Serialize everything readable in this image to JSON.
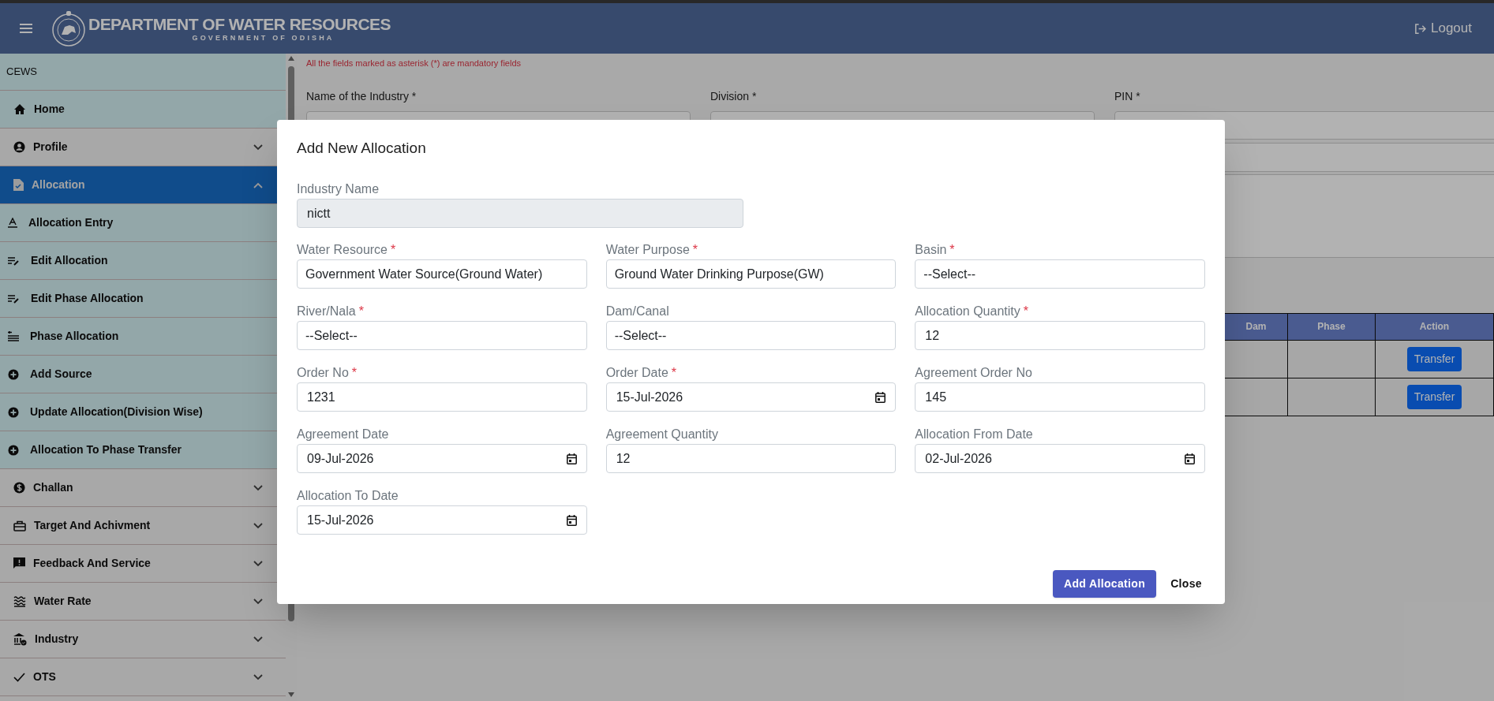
{
  "header": {
    "title": "DEPARTMENT OF WATER RESOURCES",
    "subtitle": "GOVERNMENT OF ODISHA",
    "logout": "Logout"
  },
  "sidebar": {
    "title": "CEWS",
    "items": [
      {
        "label": "Home",
        "kind": "link",
        "selected": false
      },
      {
        "label": "Profile",
        "kind": "group",
        "selected": false,
        "expanded": false
      },
      {
        "label": "Allocation",
        "kind": "group",
        "selected": true,
        "expanded": true,
        "children": [
          {
            "label": "Allocation Entry"
          },
          {
            "label": "Edit Allocation"
          },
          {
            "label": "Edit Phase Allocation"
          },
          {
            "label": "Phase Allocation"
          },
          {
            "label": "Add Source"
          },
          {
            "label": "Update Allocation(Division Wise)"
          },
          {
            "label": "Allocation To Phase Transfer"
          }
        ]
      },
      {
        "label": "Challan",
        "kind": "group",
        "selected": false,
        "expanded": false
      },
      {
        "label": "Target And Achivment",
        "kind": "group",
        "selected": false,
        "expanded": false
      },
      {
        "label": "Feedback And Service",
        "kind": "group",
        "selected": false,
        "expanded": false
      },
      {
        "label": "Water Rate",
        "kind": "group",
        "selected": false,
        "expanded": false
      },
      {
        "label": "Industry",
        "kind": "group",
        "selected": false,
        "expanded": false
      },
      {
        "label": "OTS",
        "kind": "group",
        "selected": false,
        "expanded": false
      }
    ]
  },
  "form": {
    "note": "All the fields marked as asterisk (*) are mandatory fields",
    "fields": [
      {
        "label": "Name of the Industry *"
      },
      {
        "label": "Division *"
      },
      {
        "label": "PIN *"
      }
    ]
  },
  "table": {
    "columns": [
      "Dam",
      "Phase",
      "Action"
    ],
    "rows": [
      {
        "action": "Transfer"
      },
      {
        "action": "Transfer"
      }
    ]
  },
  "modal": {
    "title": "Add New Allocation",
    "industry_name": {
      "label": "Industry Name",
      "value": "nictt",
      "disabled": true
    },
    "fields": [
      {
        "label": "Water Resource",
        "required_mark": "*",
        "kind": "select",
        "value": "Government Water Source(Ground Water)"
      },
      {
        "label": "Water Purpose",
        "required_mark": "*",
        "kind": "select",
        "value": "Ground Water Drinking Purpose(GW)"
      },
      {
        "label": "Basin",
        "required_mark": "*",
        "kind": "select",
        "value": "--Select--"
      },
      {
        "label": "River/Nala",
        "required_mark": "*",
        "kind": "select",
        "value": "--Select--"
      },
      {
        "label": "Dam/Canal",
        "kind": "select",
        "value": "--Select--"
      },
      {
        "label": "Allocation Quantity",
        "required_mark": "*",
        "kind": "text",
        "value": "12"
      },
      {
        "label": "Order No",
        "required_mark": "*",
        "kind": "text",
        "value": "1231"
      },
      {
        "label": "Order Date",
        "required_mark": "*",
        "kind": "date",
        "value": "15-Jul-2026"
      },
      {
        "label": "Agreement Order No",
        "kind": "text",
        "value": "145"
      },
      {
        "label": "Agreement Date",
        "kind": "date",
        "value": "09-Jul-2026"
      },
      {
        "label": "Agreement Quantity",
        "kind": "text",
        "value": "12"
      },
      {
        "label": "Allocation From Date",
        "kind": "date",
        "value": "02-Jul-2026"
      },
      {
        "label": "Allocation To Date",
        "kind": "date",
        "value": "15-Jul-2026"
      }
    ],
    "buttons": [
      {
        "label": "Add Allocation",
        "kind": "primary"
      },
      {
        "label": "Close",
        "kind": "plain"
      }
    ]
  }
}
